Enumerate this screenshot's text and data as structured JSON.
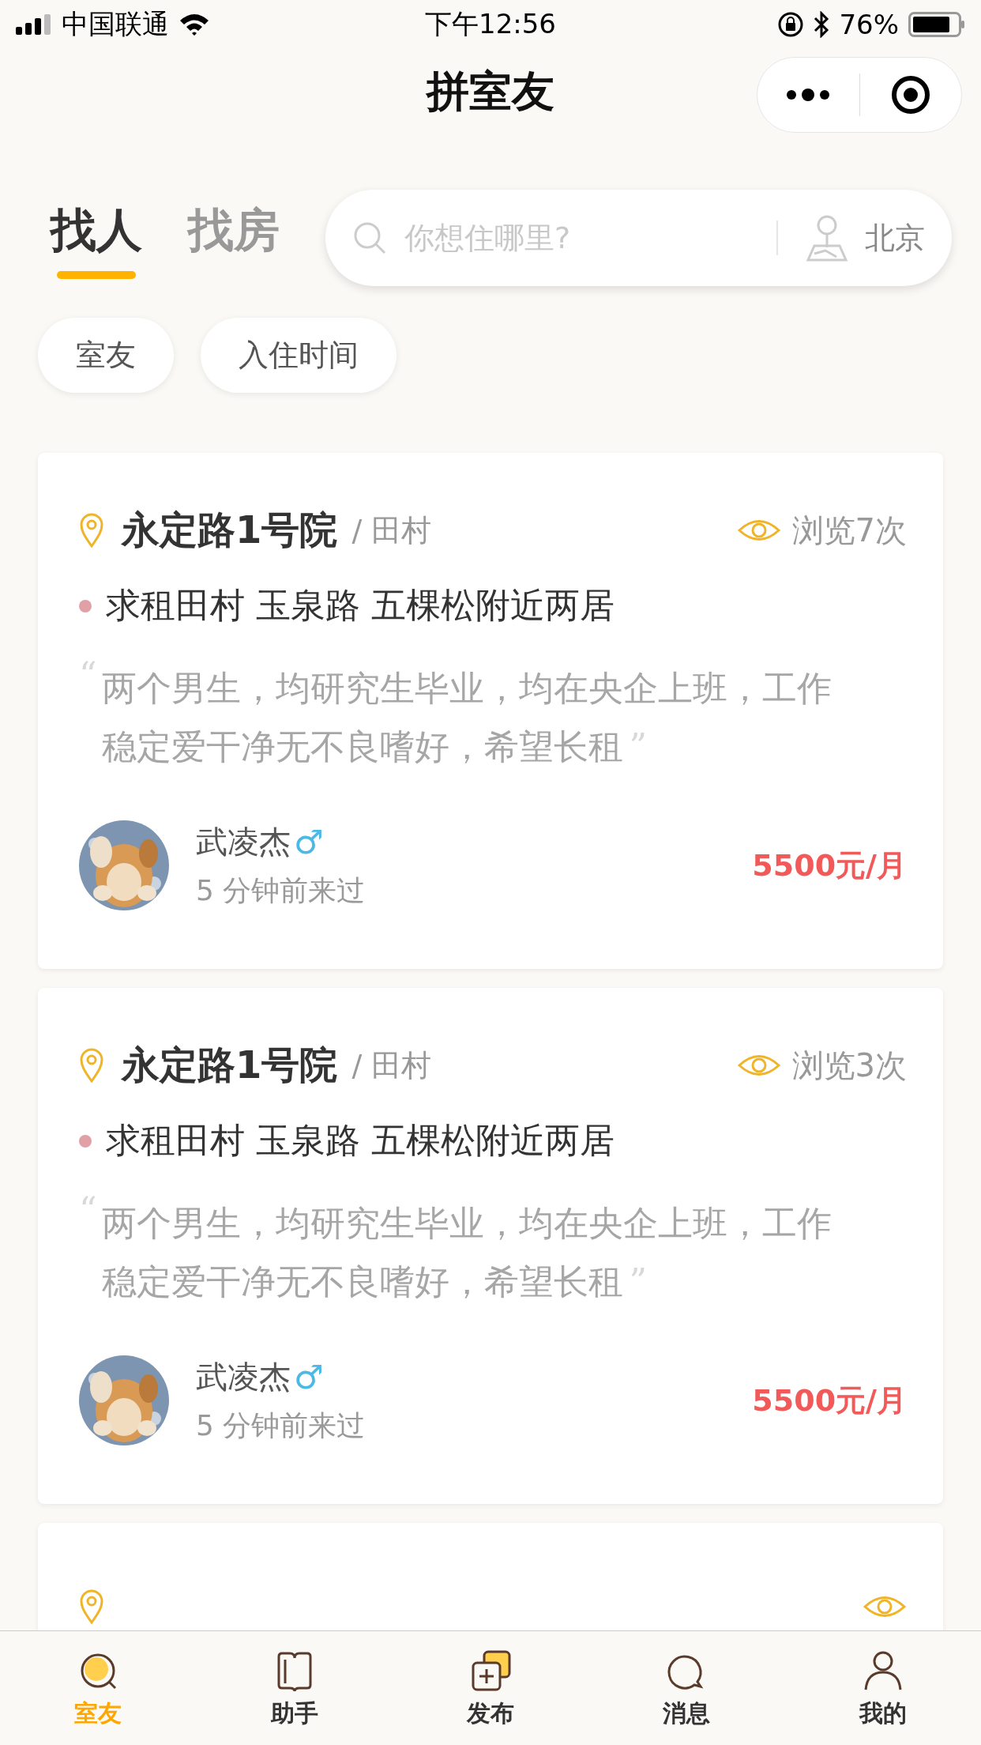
{
  "status_bar": {
    "carrier": "中国联通",
    "time": "下午12:56",
    "battery": "76%"
  },
  "nav": {
    "title": "拼室友"
  },
  "tabs": [
    {
      "label": "找人",
      "selected": true
    },
    {
      "label": "找房",
      "selected": false
    }
  ],
  "search": {
    "placeholder": "你想住哪里?",
    "city": "北京"
  },
  "filters": [
    "室友",
    "入住时间"
  ],
  "listings": [
    {
      "title": "永定路1号院",
      "area": "/ 田村",
      "views": "浏览7次",
      "tag": "求租田村 玉泉路 五棵松附近两居",
      "quote_open": "“",
      "description": "两个男生，均研究生毕业，均在央企上班，工作稳定爱干净无不良嗜好，希望长租",
      "quote_close": "”",
      "user": {
        "name": "武凌杰",
        "gender": "♂",
        "last_seen": "5 分钟前来过"
      },
      "price": "5500元/月"
    },
    {
      "title": "永定路1号院",
      "area": "/ 田村",
      "views": "浏览3次",
      "tag": "求租田村 玉泉路 五棵松附近两居",
      "quote_open": "“",
      "description": "两个男生，均研究生毕业，均在央企上班，工作稳定爱干净无不良嗜好，希望长租",
      "quote_close": "”",
      "user": {
        "name": "武凌杰",
        "gender": "♂",
        "last_seen": "5 分钟前来过"
      },
      "price": "5500元/月"
    },
    {
      "kind": "peek"
    }
  ],
  "tab_bar": [
    {
      "label": "室友",
      "selected": true
    },
    {
      "label": "助手",
      "selected": false
    },
    {
      "label": "发布",
      "selected": false
    },
    {
      "label": "消息",
      "selected": false
    },
    {
      "label": "我的",
      "selected": false
    }
  ]
}
